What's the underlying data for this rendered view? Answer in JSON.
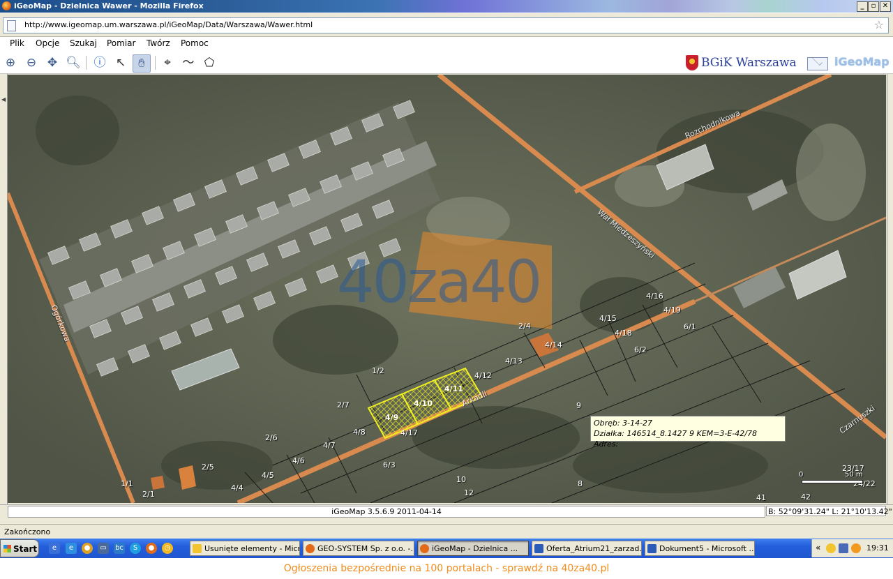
{
  "window": {
    "title": "iGeoMap - Dzielnica Wawer - Mozilla Firefox",
    "icon": "firefox-icon",
    "controls": [
      "_",
      "▫",
      "✕"
    ]
  },
  "address_bar": {
    "url": "http://www.igeomap.um.warszawa.pl/iGeoMap/Data/Warszawa/Wawer.html",
    "bookmark_icon": "star-icon"
  },
  "menu": {
    "items": [
      "Plik",
      "Opcje",
      "Szukaj",
      "Pomiar",
      "Twórz",
      "Pomoc"
    ]
  },
  "toolbar": {
    "tools": [
      "zoom-in-icon",
      "zoom-out-icon",
      "pan-arrows-icon",
      "zoom-window-icon",
      "info-icon",
      "select-arrow-icon",
      "hand-icon",
      "crosshair-icon",
      "line-icon",
      "polygon-icon"
    ],
    "brand_text": "BGiK Warszawa",
    "app_logo": "iGeoMap"
  },
  "map": {
    "watermark": "40za40",
    "streets": [
      "Rozchodnikowa",
      "Wał Miedzeszyński",
      "Ogórkowa",
      "Arkadii",
      "Czarnuszki"
    ],
    "parcels": [
      "4/16",
      "4/19",
      "4/15",
      "6/1",
      "2/4",
      "4/18",
      "4/14",
      "6/2",
      "4/13",
      "1/2",
      "4/12",
      "4/11",
      "4/10",
      "2/7",
      "4/9",
      "4/8",
      "4/17",
      "9",
      "2/6",
      "4/7",
      "4/6",
      "6/3",
      "2/5",
      "4/5",
      "1/1",
      "2/1",
      "4/4",
      "10",
      "8",
      "12",
      "41",
      "42",
      "23/17",
      "24/22"
    ],
    "highlighted_parcels": [
      "4/9",
      "4/10",
      "4/11"
    ],
    "tooltip": {
      "line1": "Obręb: 3-14-27",
      "line2": "Działka: 146514_8.1427 9 KEM=3-E-42/78 Adres:"
    },
    "scale": {
      "left": "0",
      "right": "50 m"
    },
    "highlight_color": "#e8e820",
    "road_color": "#d98a4e"
  },
  "map_status": {
    "version": "iGeoMap 3.5.6.9 2011-04-14",
    "coords": "B: 52°09'31.24\" L: 21°10'13.42\""
  },
  "browser_status": "Zakończono",
  "taskbar": {
    "start": "Start",
    "tasks": [
      "Usunięte elementy - Micr...",
      "GEO-SYSTEM Sp. z o.o. -...",
      "iGeoMap - Dzielnica ...",
      "Oferta_Atrium21_zarzad...",
      "Dokument5 - Microsoft ..."
    ],
    "clock": "19:31",
    "tray_toggle": "«"
  },
  "banner": "Ogłoszenia bezpośrednie na 100 portalach - sprawdź na 40za40.pl"
}
